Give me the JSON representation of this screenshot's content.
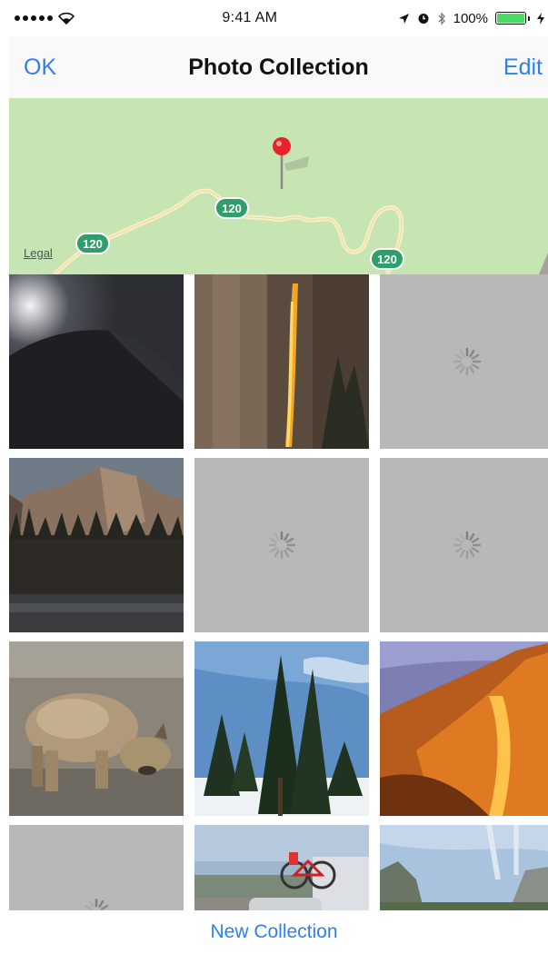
{
  "status_bar": {
    "time": "9:41 AM",
    "battery": "100%"
  },
  "nav": {
    "left_label": "OK",
    "title": "Photo Collection",
    "right_label": "Edit"
  },
  "map": {
    "legal_label": "Legal",
    "route_badges": [
      "120",
      "120",
      "120"
    ]
  },
  "photos": [
    {
      "state": "loaded",
      "subject": "half dome at night"
    },
    {
      "state": "loaded",
      "subject": "firefall rock face"
    },
    {
      "state": "loading"
    },
    {
      "state": "loaded",
      "subject": "half dome at dusk"
    },
    {
      "state": "loading"
    },
    {
      "state": "loading"
    },
    {
      "state": "loaded",
      "subject": "bobcat"
    },
    {
      "state": "loaded",
      "subject": "pine trees in snow"
    },
    {
      "state": "loaded",
      "subject": "firefall at sunset"
    },
    {
      "state": "loading"
    },
    {
      "state": "loaded",
      "subject": "car with bikes"
    },
    {
      "state": "loaded",
      "subject": "valley cliffs"
    }
  ],
  "toolbar": {
    "new_collection_label": "New Collection"
  },
  "colors": {
    "accent": "#2f80ed",
    "map_green": "#c6e5b3",
    "placeholder_gray": "#b8b8b8",
    "battery_green": "#4cd964"
  }
}
